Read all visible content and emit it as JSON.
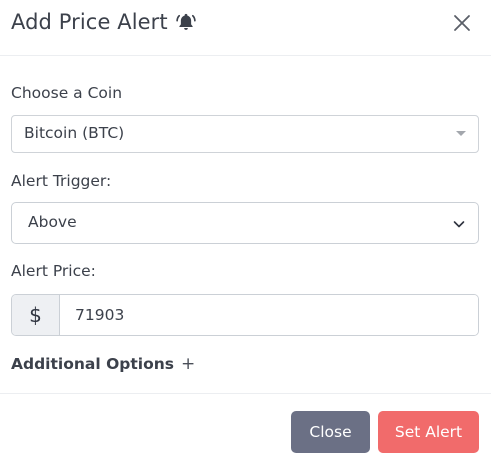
{
  "modal": {
    "title": "Add Price Alert",
    "title_icon": "bell-ringing-icon",
    "close_icon": "close-icon"
  },
  "coin": {
    "label": "Choose a Coin",
    "selected": "Bitcoin (BTC)",
    "caret_icon": "caret-down-icon"
  },
  "trigger": {
    "label": "Alert Trigger:",
    "selected": "Above",
    "chevron_icon": "chevron-down-icon"
  },
  "price": {
    "label": "Alert Price:",
    "currency_symbol": "$",
    "value": "71903"
  },
  "additional_options": {
    "label": "Additional Options",
    "icon": "plus-icon",
    "symbol": "+"
  },
  "footer": {
    "close_label": "Close",
    "set_label": "Set Alert"
  },
  "colors": {
    "close_button": "#6b7085",
    "set_button": "#f16b6b",
    "text": "#3c414b",
    "border": "#cbd0d6"
  }
}
